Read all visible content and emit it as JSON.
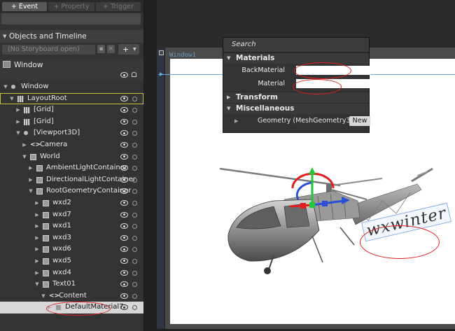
{
  "toolbar": {
    "event_label": "+ Event",
    "property_label": "+ Property",
    "trigger_label": "+ Trigger"
  },
  "objects_panel": {
    "title": "Objects and Timeline",
    "storyboard_placeholder": "(No Storyboard open)",
    "add_storyboard_label": "+",
    "scope_label": "Window"
  },
  "tree": [
    {
      "label": "Window",
      "depth": 0,
      "kind": "vp",
      "expanded": true
    },
    {
      "label": "LayoutRoot",
      "depth": 1,
      "kind": "grid",
      "expanded": true,
      "boxed": true
    },
    {
      "label": "[Grid]",
      "depth": 2,
      "kind": "grid",
      "expanded": false
    },
    {
      "label": "[Grid]",
      "depth": 2,
      "kind": "grid",
      "expanded": false
    },
    {
      "label": "[Viewport3D]",
      "depth": 2,
      "kind": "vp",
      "expanded": true
    },
    {
      "label": "Camera",
      "depth": 3,
      "kind": "bracket",
      "expanded": false
    },
    {
      "label": "World",
      "depth": 3,
      "kind": "cube",
      "expanded": true
    },
    {
      "label": "AmbientLightContainer",
      "depth": 4,
      "kind": "cube",
      "expanded": false
    },
    {
      "label": "DirectionalLightContainer",
      "depth": 4,
      "kind": "cube",
      "expanded": false
    },
    {
      "label": "RootGeometryContainer",
      "depth": 4,
      "kind": "cube",
      "expanded": true
    },
    {
      "label": "wxd2",
      "depth": 5,
      "kind": "cube",
      "expanded": false
    },
    {
      "label": "wxd7",
      "depth": 5,
      "kind": "cube",
      "expanded": false
    },
    {
      "label": "wxd1",
      "depth": 5,
      "kind": "cube",
      "expanded": false
    },
    {
      "label": "wxd3",
      "depth": 5,
      "kind": "cube",
      "expanded": false
    },
    {
      "label": "wxd6",
      "depth": 5,
      "kind": "cube",
      "expanded": false
    },
    {
      "label": "wxd5",
      "depth": 5,
      "kind": "cube",
      "expanded": false
    },
    {
      "label": "wxd4",
      "depth": 5,
      "kind": "cube",
      "expanded": false
    },
    {
      "label": "Text01",
      "depth": 5,
      "kind": "cube",
      "expanded": true
    },
    {
      "label": "Content",
      "depth": 6,
      "kind": "bracket",
      "expanded": true
    },
    {
      "label": "DefaultMaterial7",
      "depth": 7,
      "kind": "cube",
      "expanded": false,
      "selected": true
    }
  ],
  "canvas": {
    "window_tab": "Window1",
    "text3d": "wxwinter"
  },
  "properties": {
    "search_placeholder": "Search",
    "categories": {
      "materials": "Materials",
      "transform": "Transform",
      "misc": "Miscellaneous"
    },
    "back_material_label": "BackMaterial",
    "material_label": "Material",
    "geometry_label": "Geometry (MeshGeometry3...",
    "new_button": "New"
  },
  "colors": {
    "annotation_red": "#e02020",
    "selection_yellow": "#c8c040",
    "axis_red": "#e21e1e",
    "axis_green": "#22c43a",
    "axis_blue": "#2a4fd8"
  }
}
